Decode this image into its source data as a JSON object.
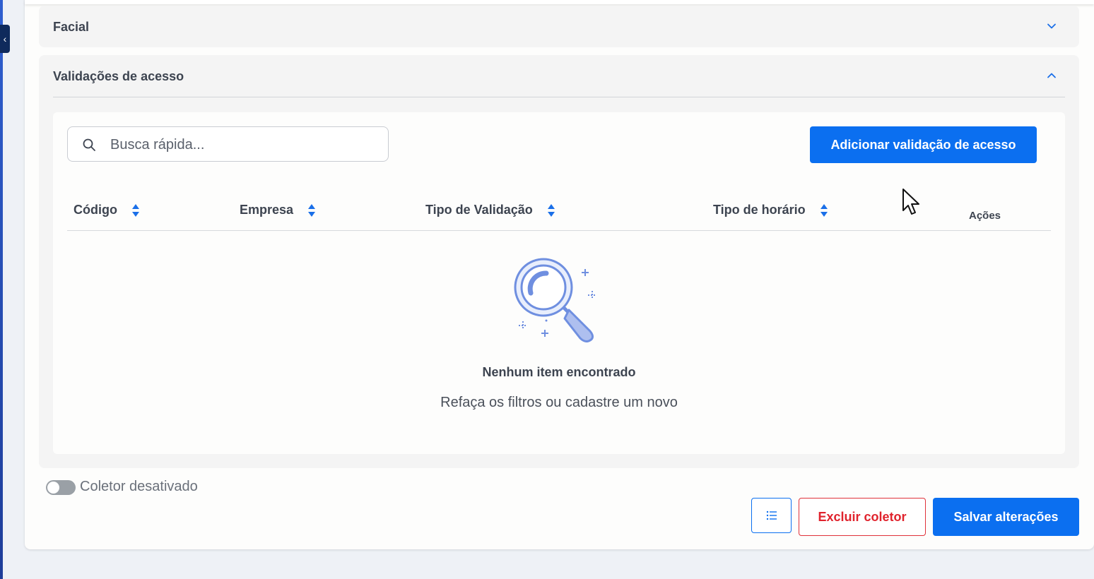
{
  "sections": {
    "facial": {
      "title": "Facial",
      "expanded": false
    },
    "validacoes": {
      "title": "Validações de acesso",
      "expanded": true
    }
  },
  "search": {
    "placeholder": "Busca rápida...",
    "value": ""
  },
  "actions": {
    "add_label": "Adicionar validação de acesso"
  },
  "table": {
    "columns": [
      "Código",
      "Empresa",
      "Tipo de Validação",
      "Tipo de horário"
    ],
    "actions_header": "Ações",
    "rows": []
  },
  "empty_state": {
    "title": "Nenhum item encontrado",
    "subtitle": "Refaça os filtros ou cadastre um novo"
  },
  "collector": {
    "toggle_label": "Coletor desativado",
    "enabled": false
  },
  "footer": {
    "delete_label": "Excluir coletor",
    "save_label": "Salvar alterações"
  },
  "colors": {
    "primary": "#0b6ff0",
    "danger": "#e0232d"
  },
  "icons": [
    "search-icon",
    "chevron-down-icon",
    "chevron-up-icon",
    "sort-icon",
    "magnifier-illustration",
    "list-icon"
  ]
}
